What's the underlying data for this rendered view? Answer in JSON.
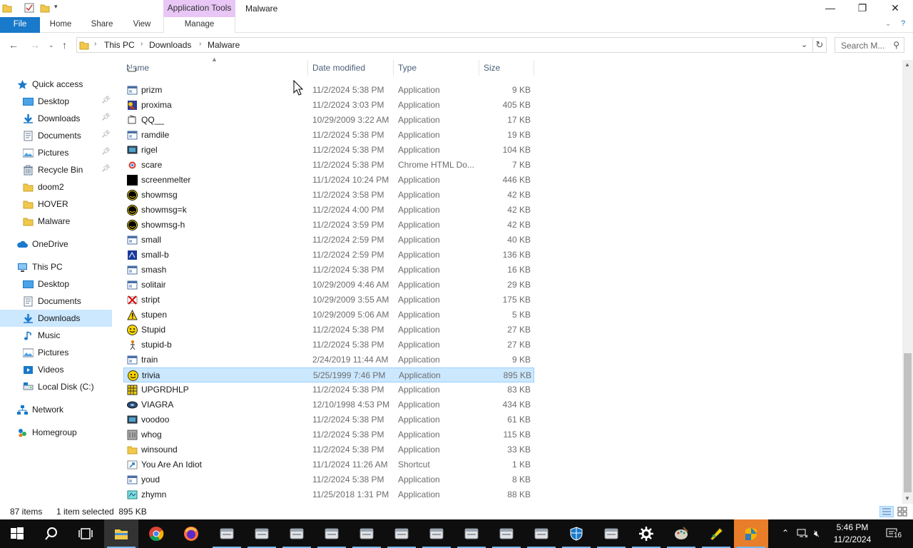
{
  "window": {
    "app_tools_label": "Application Tools",
    "title": "Malware"
  },
  "ribbon": {
    "tabs": [
      "File",
      "Home",
      "Share",
      "View",
      "Manage"
    ]
  },
  "address": {
    "crumbs": [
      "This PC",
      "Downloads",
      "Malware"
    ],
    "search_placeholder": "Search M..."
  },
  "columns": {
    "name": "Name",
    "date": "Date modified",
    "type": "Type",
    "size": "Size"
  },
  "nav": {
    "items": [
      {
        "label": "Quick access",
        "icon": "star-icon"
      },
      {
        "label": "Desktop",
        "icon": "desktop-icon",
        "pinned": true
      },
      {
        "label": "Downloads",
        "icon": "downloads-icon",
        "pinned": true
      },
      {
        "label": "Documents",
        "icon": "documents-icon",
        "pinned": true
      },
      {
        "label": "Pictures",
        "icon": "pictures-icon",
        "pinned": true
      },
      {
        "label": "Recycle Bin",
        "icon": "recycle-bin-icon",
        "pinned": true
      },
      {
        "label": "doom2",
        "icon": "folder-icon"
      },
      {
        "label": "HOVER",
        "icon": "folder-icon"
      },
      {
        "label": "Malware",
        "icon": "folder-icon"
      },
      {
        "label": "OneDrive",
        "icon": "cloud-icon"
      },
      {
        "label": "This PC",
        "icon": "computer-icon"
      },
      {
        "label": "Desktop",
        "icon": "desktop-icon"
      },
      {
        "label": "Documents",
        "icon": "documents-icon"
      },
      {
        "label": "Downloads",
        "icon": "downloads-icon",
        "selected": true
      },
      {
        "label": "Music",
        "icon": "music-icon"
      },
      {
        "label": "Pictures",
        "icon": "pictures-icon"
      },
      {
        "label": "Videos",
        "icon": "videos-icon"
      },
      {
        "label": "Local Disk (C:)",
        "icon": "disk-icon"
      },
      {
        "label": "Network",
        "icon": "network-icon"
      },
      {
        "label": "Homegroup",
        "icon": "homegroup-icon"
      }
    ]
  },
  "files": [
    {
      "name": "prizm",
      "date": "11/2/2024 5:38 PM",
      "type": "Application",
      "size": "9 KB",
      "icon": "app-window-icon"
    },
    {
      "name": "proxima",
      "date": "11/2/2024 3:03 PM",
      "type": "Application",
      "size": "405 KB",
      "icon": "app-colorful-icon"
    },
    {
      "name": "QQ__",
      "date": "10/29/2009 3:22 AM",
      "type": "Application",
      "size": "17 KB",
      "icon": "app-generic-icon"
    },
    {
      "name": "ramdile",
      "date": "11/2/2024 5:38 PM",
      "type": "Application",
      "size": "19 KB",
      "icon": "app-window-icon"
    },
    {
      "name": "rigel",
      "date": "11/2/2024 5:38 PM",
      "type": "Application",
      "size": "104 KB",
      "icon": "app-monitor-icon"
    },
    {
      "name": "scare",
      "date": "11/2/2024 5:38 PM",
      "type": "Chrome HTML Do...",
      "size": "7 KB",
      "icon": "chrome-doc-icon"
    },
    {
      "name": "screenmelter",
      "date": "11/1/2024 10:24 PM",
      "type": "Application",
      "size": "446 KB",
      "icon": "black-square-icon"
    },
    {
      "name": "showmsg",
      "date": "11/2/2024 3:58 PM",
      "type": "Application",
      "size": "42 KB",
      "icon": "smiley-dark-icon"
    },
    {
      "name": "showmsg=k",
      "date": "11/2/2024 4:00 PM",
      "type": "Application",
      "size": "42 KB",
      "icon": "smiley-dark-icon"
    },
    {
      "name": "showmsg-h",
      "date": "11/2/2024 3:59 PM",
      "type": "Application",
      "size": "42 KB",
      "icon": "smiley-dark-icon"
    },
    {
      "name": "small",
      "date": "11/2/2024 2:59 PM",
      "type": "Application",
      "size": "40 KB",
      "icon": "app-window-icon"
    },
    {
      "name": "small-b",
      "date": "11/2/2024 2:59 PM",
      "type": "Application",
      "size": "136 KB",
      "icon": "app-blue-icon"
    },
    {
      "name": "smash",
      "date": "11/2/2024 5:38 PM",
      "type": "Application",
      "size": "16 KB",
      "icon": "app-window-icon"
    },
    {
      "name": "solitair",
      "date": "10/29/2009 4:46 AM",
      "type": "Application",
      "size": "29 KB",
      "icon": "app-window-icon"
    },
    {
      "name": "stript",
      "date": "10/29/2009 3:55 AM",
      "type": "Application",
      "size": "175 KB",
      "icon": "red-x-icon"
    },
    {
      "name": "stupen",
      "date": "10/29/2009 5:06 AM",
      "type": "Application",
      "size": "5 KB",
      "icon": "warning-icon"
    },
    {
      "name": "Stupid",
      "date": "11/2/2024 5:38 PM",
      "type": "Application",
      "size": "27 KB",
      "icon": "smiley-yellow-icon"
    },
    {
      "name": "stupid-b",
      "date": "11/2/2024 5:38 PM",
      "type": "Application",
      "size": "27 KB",
      "icon": "app-figure-icon"
    },
    {
      "name": "train",
      "date": "2/24/2019 11:44 AM",
      "type": "Application",
      "size": "9 KB",
      "icon": "app-window-icon"
    },
    {
      "name": "trivia",
      "date": "5/25/1999 7:46 PM",
      "type": "Application",
      "size": "895 KB",
      "icon": "smiley-yellow-icon",
      "selected": true
    },
    {
      "name": "UPGRDHLP",
      "date": "11/2/2024 5:38 PM",
      "type": "Application",
      "size": "83 KB",
      "icon": "app-grid-icon"
    },
    {
      "name": "VIAGRA",
      "date": "12/10/1998 4:53 PM",
      "type": "Application",
      "size": "434 KB",
      "icon": "app-disc-icon"
    },
    {
      "name": "voodoo",
      "date": "11/2/2024 5:38 PM",
      "type": "Application",
      "size": "61 KB",
      "icon": "app-monitor-icon"
    },
    {
      "name": "whog",
      "date": "11/2/2024 5:38 PM",
      "type": "Application",
      "size": "115 KB",
      "icon": "app-gray-icon"
    },
    {
      "name": "winsound",
      "date": "11/2/2024 5:38 PM",
      "type": "Application",
      "size": "33 KB",
      "icon": "folder-icon"
    },
    {
      "name": "You Are An Idiot",
      "date": "11/1/2024 11:26 AM",
      "type": "Shortcut",
      "size": "1 KB",
      "icon": "shortcut-icon"
    },
    {
      "name": "youd",
      "date": "11/2/2024 5:38 PM",
      "type": "Application",
      "size": "8 KB",
      "icon": "app-window-icon"
    },
    {
      "name": "zhymn",
      "date": "11/25/2018 1:31 PM",
      "type": "Application",
      "size": "88 KB",
      "icon": "app-cyan-icon"
    }
  ],
  "status": {
    "count": "87 items",
    "selection": "1 item selected  895 KB"
  },
  "taskbar": {
    "time": "5:46 PM",
    "date": "11/2/2024",
    "notification_count": "16"
  },
  "colors": {
    "selection": "#cce8ff",
    "accent": "#1979ca",
    "app_tools": "#e8c6f5"
  }
}
